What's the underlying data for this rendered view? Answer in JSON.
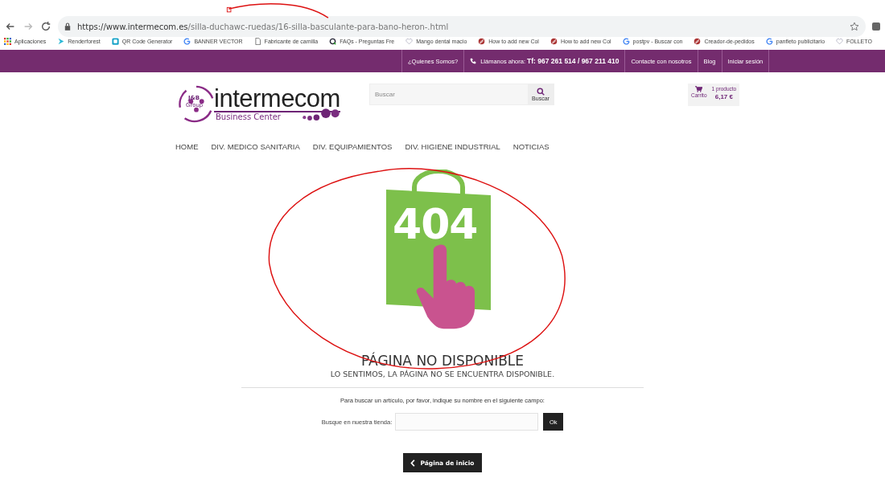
{
  "browser": {
    "url_host": "https://www.intermecom.es",
    "url_path": "/silla-duchawc-ruedas/16-silla-basculante-para-bano-heron-.html"
  },
  "bookmarks": [
    {
      "label": "Aplicaciones",
      "kind": "apps"
    },
    {
      "label": "Renderforest",
      "kind": "play"
    },
    {
      "label": "QR Code Generator",
      "kind": "qr"
    },
    {
      "label": "BANNER VECTOR",
      "kind": "google"
    },
    {
      "label": "Fabricante de camilla",
      "kind": "doc"
    },
    {
      "label": "FAQs - Preguntas Fre",
      "kind": "faq"
    },
    {
      "label": "Mango dental macio",
      "kind": "heart"
    },
    {
      "label": "How to add new Col",
      "kind": "swirl"
    },
    {
      "label": "How to add new Col",
      "kind": "swirl"
    },
    {
      "label": "postpv - Buscar con",
      "kind": "google"
    },
    {
      "label": "Creador-de-pedidos",
      "kind": "swirl"
    },
    {
      "label": "panfleto publicitario",
      "kind": "google"
    },
    {
      "label": "FOLLETO",
      "kind": "heart"
    }
  ],
  "topbar": {
    "about": "¿Quienes Somos?",
    "call_label": "Llámanos ahora:",
    "phones": "Tf: 967 261 514 / 967 211 410",
    "links": [
      "Contacte con nosotros",
      "Blog",
      "Iniciar sesión"
    ]
  },
  "header": {
    "logo_badge": "J&B",
    "logo_badge_sub": "Group",
    "logo_name": "intermecom",
    "logo_tagline": "Business Center",
    "search_placeholder": "Buscar",
    "search_button": "Buscar",
    "cart_label": "Carrito",
    "cart_count": "1 producto",
    "cart_total": "6,17 €"
  },
  "nav": [
    "HOME",
    "DIV. MEDICO SANITARIA",
    "DIV. EQUIPAMIENTOS",
    "DIV. HIGIENE INDUSTRIAL",
    "NOTICIAS"
  ],
  "error": {
    "code": "404",
    "title": "PÁGINA NO DISPONIBLE",
    "subtitle": "LO SENTIMOS, LA PÁGINA NO SE ENCUENTRA DISPONIBLE.",
    "hint": "Para buscar un artículo, por favor, indique su nombre en el siguiente campo:",
    "search_label": "Busque en nuestra tienda:",
    "ok_button": "Ok",
    "home_button": "Página de inicio"
  }
}
